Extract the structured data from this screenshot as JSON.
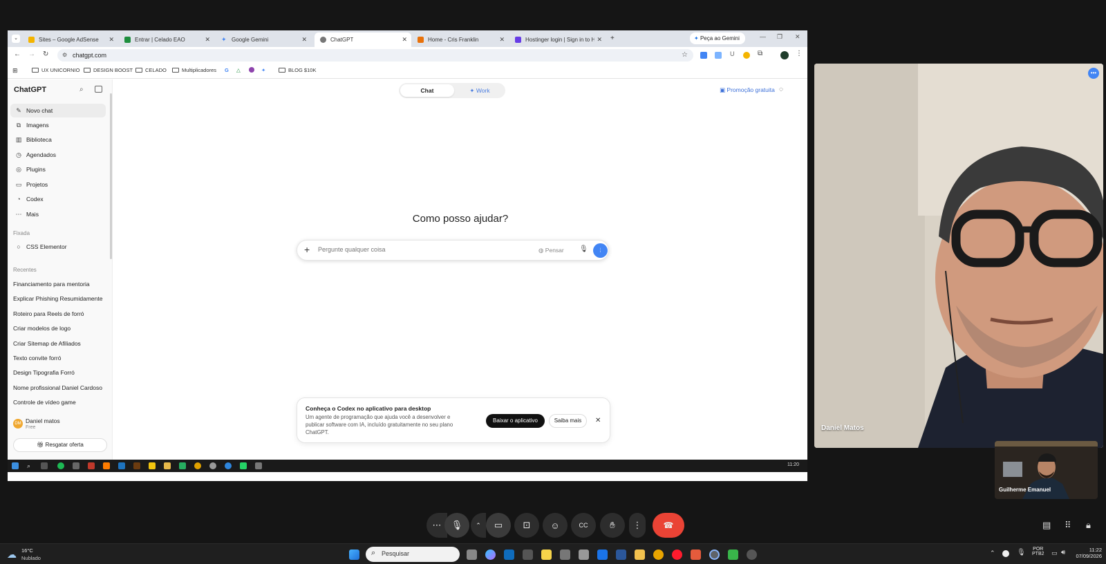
{
  "browser": {
    "tabs": [
      {
        "title": "Sites – Google AdSense",
        "color": "#f4b400"
      },
      {
        "title": "Entrar | Celado EAO",
        "color": "#1e8e3e"
      },
      {
        "title": "Google Gemini",
        "color": "#4285f4"
      },
      {
        "title": "ChatGPT",
        "color": "#777777",
        "active": true
      },
      {
        "title": "Home - Cris Franklin",
        "color": "#e8710a"
      },
      {
        "title": "Hostinger login | Sign in to Ho...",
        "color": "#673de6"
      }
    ],
    "gemini_button": "Peça ao Gemini",
    "url": "chatgpt.com",
    "bookmarks": [
      "UX UNICORNIO",
      "DESIGN BOOST",
      "CELADO",
      "Multiplicadores",
      "BLOG $10K"
    ]
  },
  "chatgpt": {
    "brand": "ChatGPT",
    "nav": [
      {
        "label": "Novo chat",
        "icon": "edit-icon"
      },
      {
        "label": "Imagens",
        "icon": "images-icon"
      },
      {
        "label": "Biblioteca",
        "icon": "library-icon"
      },
      {
        "label": "Agendados",
        "icon": "clock-icon"
      },
      {
        "label": "Plugins",
        "icon": "plugins-icon"
      },
      {
        "label": "Projetos",
        "icon": "folder-icon"
      },
      {
        "label": "Codex",
        "icon": "codex-icon"
      },
      {
        "label": "Mais",
        "icon": "more-icon"
      }
    ],
    "pinned_label": "Fixada",
    "pinned": [
      "CSS Elementor"
    ],
    "recent_label": "Recentes",
    "recents": [
      "Financiamento para mentoria",
      "Explicar Phishing Resumidamente",
      "Roteiro para Reels de forró",
      "Criar modelos de logo",
      "Criar Sitemap de Afiliados",
      "Texto convite forró",
      "Design Tipografia Forró",
      "Nome profissional Daniel Cardoso",
      "Controle de vídeo game"
    ],
    "user": {
      "initials": "DM",
      "name": "Daniel matos",
      "plan": "Free"
    },
    "offer_button": "Resgatar oferta",
    "modes": {
      "chat": "Chat",
      "work": "✦ Work"
    },
    "promo": "Promoção gratuita",
    "heading": "Como posso ajudar?",
    "composer": {
      "placeholder": "Pergunte qualquer coisa",
      "think": "Pensar"
    },
    "codex_banner": {
      "title": "Conheça o Codex no aplicativo para desktop",
      "body": "Um agente de programação que ajuda você a desenvolver e publicar software com IA, incluído gratuitamente no seu plano ChatGPT.",
      "primary": "Baixar o aplicativo",
      "secondary": "Saiba mais"
    }
  },
  "inner_clock": "11:20",
  "meet": {
    "main_participant": "Daniel Matos",
    "small_participant": "Guilherme Emanuel"
  },
  "taskbar": {
    "weather_temp": "16°C",
    "weather_desc": "Nublado",
    "search_placeholder": "Pesquisar",
    "lang_top": "POR",
    "lang_bottom": "PTB2",
    "time": "11:22",
    "date": "07/09/2026"
  },
  "colors": {
    "accent": "#4285f4",
    "end_call": "#ea4335",
    "gemini_blue": "#1a73e8"
  }
}
